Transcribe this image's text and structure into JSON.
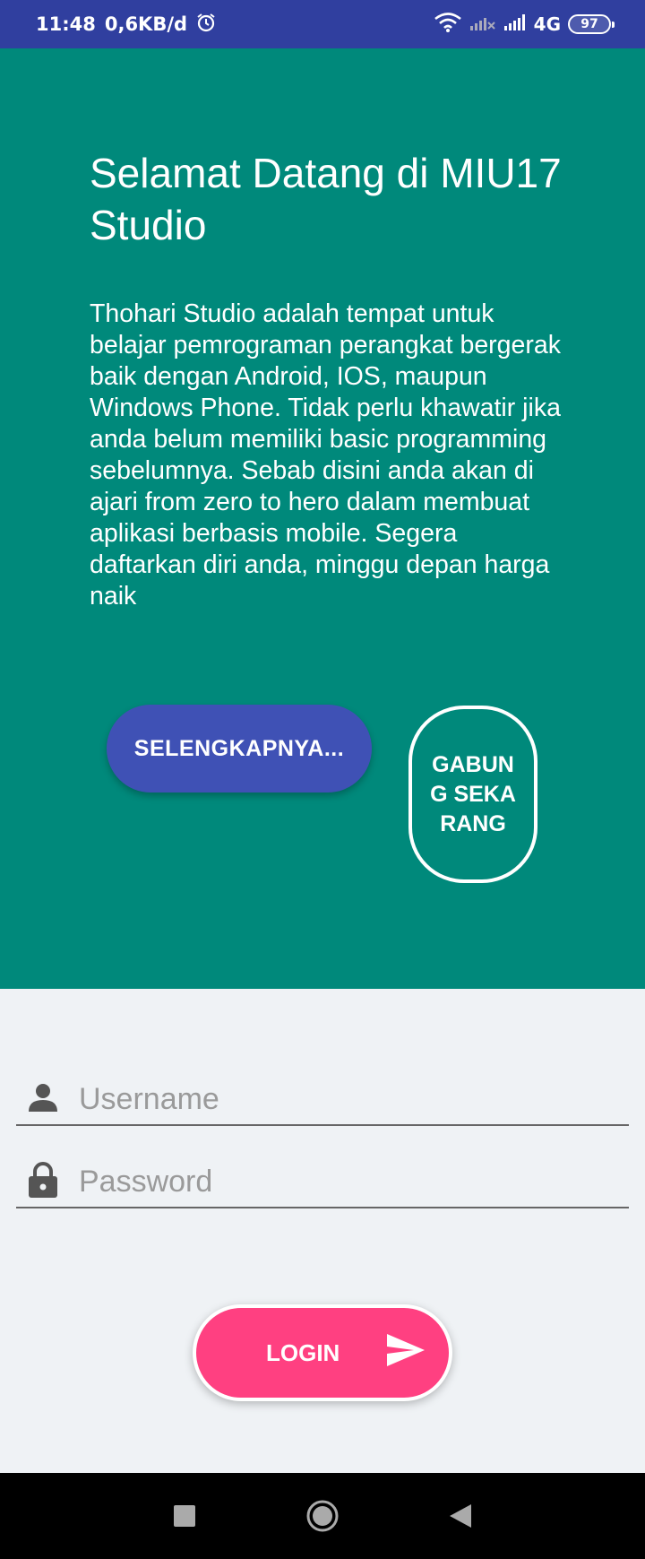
{
  "status_bar": {
    "time": "11:48",
    "data_rate": "0,6KB/d",
    "network_type": "4G",
    "battery": "97",
    "icons": [
      "alarm-icon",
      "wifi-icon",
      "signal-off-icon",
      "signal-icon",
      "battery-icon"
    ]
  },
  "hero": {
    "title": "Selamat Datang di MIU17 Studio",
    "description": "Thohari Studio adalah tempat untuk belajar pemrograman perangkat bergerak baik dengan Android, IOS, maupun Windows Phone. Tidak perlu khawatir jika anda belum memiliki basic programming sebelumnya. Sebab disini anda akan di ajari from zero to hero dalam membuat aplikasi berbasis mobile. Segera daftarkan diri anda, minggu depan harga naik",
    "more_button": "SELENGKAPNYA...",
    "join_button": "GABUNG SEKARANG"
  },
  "login": {
    "username_placeholder": "Username",
    "password_placeholder": "Password",
    "login_button": "LOGIN"
  },
  "colors": {
    "status_bar": "#303f9f",
    "hero_bg": "#00897b",
    "more_button": "#3f51b5",
    "login_button": "#ff4081",
    "page_bg": "#eff2f5"
  }
}
